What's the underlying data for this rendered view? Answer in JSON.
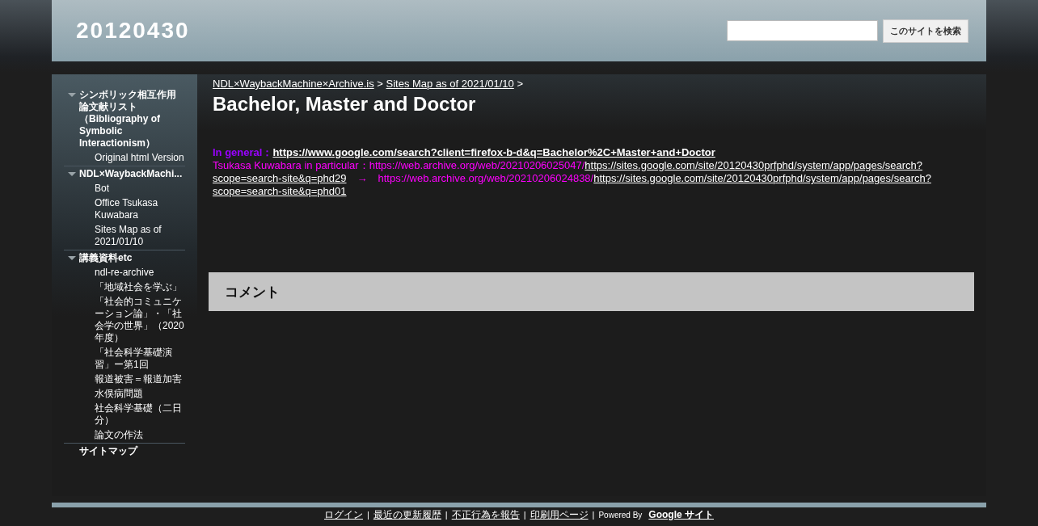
{
  "header": {
    "site_title": "20120430",
    "search": {
      "button": "このサイトを検索"
    }
  },
  "sidebar": {
    "items": [
      {
        "label": "シンボリック相互作用論文献リスト（Bibliography of Symbolic Interactionism）",
        "expanded": true,
        "children": [
          {
            "label": "Original html Version"
          }
        ]
      },
      {
        "label": "NDL×WaybackMachi...",
        "expanded": true,
        "children": [
          {
            "label": "Bot"
          },
          {
            "label": "Office Tsukasa Kuwabara"
          },
          {
            "label": "Sites Map as of 2021/01/10"
          }
        ]
      },
      {
        "label": "講義資料etc",
        "expanded": true,
        "children": [
          {
            "label": "ndl-re-archive"
          },
          {
            "label": "「地域社会を学ぶ」"
          },
          {
            "label": "「社会的コミュニケーション論」・「社会学の世界」（2020年度）"
          },
          {
            "label": "「社会科学基礎演習」ー第1回"
          },
          {
            "label": "報道被害＝報道加害"
          },
          {
            "label": "水俣病問題"
          },
          {
            "label": "社会科学基礎（二日分）"
          },
          {
            "label": "論文の作法"
          }
        ]
      },
      {
        "label": "サイトマップ"
      }
    ]
  },
  "breadcrumb": [
    {
      "label": "NDL×WaybackMachine×Archive.is",
      "separator": ">"
    },
    {
      "label": "Sites Map as of 2021/01/10",
      "separator": ">"
    }
  ],
  "page_title": "Bachelor, Master and Doctor",
  "paragraphs": [
    [
      {
        "kind": "text",
        "text": "In general：",
        "color": "#9900ff",
        "bold": true
      },
      {
        "kind": "link",
        "text": "https://www.google.com/search?client=firefox-b-d&q=Bachelor%2C+Master+and+Doctor",
        "bold": true
      }
    ],
    [
      {
        "kind": "text",
        "text": "Tsukasa Kuwabara in particular：https://web.archive.org/web/20210206025047/",
        "color": "#ff00ff"
      },
      {
        "kind": "link",
        "text": "https://sites.google.com/site/20120430prfphd/system/app/pages/search?"
      },
      {
        "kind": "link",
        "text": "scope=search-site&q=phd29"
      },
      {
        "kind": "text",
        "text": "　→　https://web.archive.org/web/20210206024838/",
        "color": "#ff00ff"
      },
      {
        "kind": "link",
        "text": "https://sites.google.com/site/20120430prfphd/system/app/pages/search?"
      },
      {
        "kind": "link",
        "text": "scope=search-site&q=phd01"
      }
    ]
  ],
  "comments": {
    "title": "コメント"
  },
  "footer": {
    "links": [
      {
        "label": "ログイン",
        "separator": "|"
      },
      {
        "label": "最近の更新履歴",
        "separator": "|"
      },
      {
        "label": "不正行為を報告",
        "separator": "|"
      },
      {
        "label": "印刷用ページ",
        "separator": "|"
      }
    ],
    "powered_by": "Powered By",
    "brand_link": "Google サイト"
  }
}
